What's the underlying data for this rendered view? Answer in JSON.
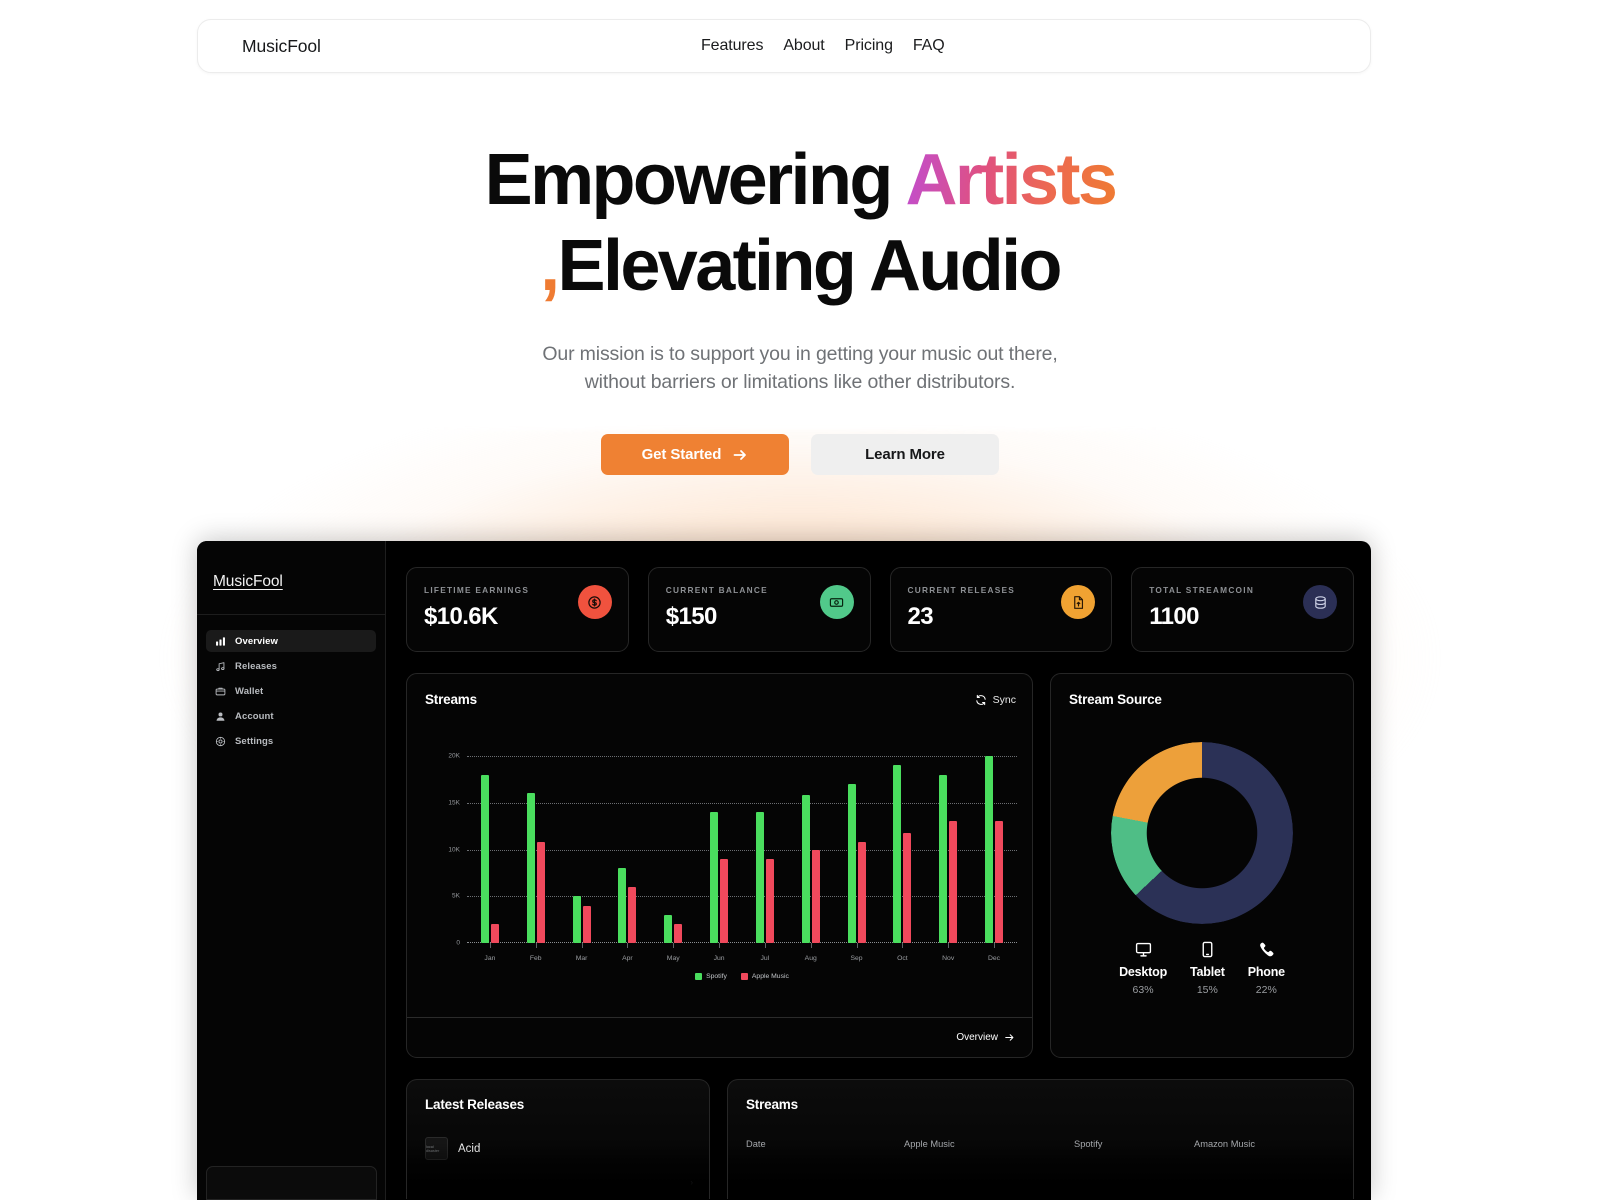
{
  "navbar": {
    "brand": "MusicFool",
    "links": [
      {
        "label": "Features"
      },
      {
        "label": "About"
      },
      {
        "label": "Pricing"
      },
      {
        "label": "FAQ"
      }
    ]
  },
  "hero": {
    "heading_part1": "Empowering",
    "heading_accent": "Artists",
    "heading_comma": ",",
    "heading_part2": "Elevating Audio",
    "subheading_line1": "Our mission is to support you in getting your music out there,",
    "subheading_line2": "without barriers or limitations like other distributors.",
    "cta_primary": "Get Started",
    "cta_secondary": "Learn More",
    "accent_gradient_from": "#c04ed1",
    "accent_gradient_to": "#ef7b32",
    "primary_button_color": "#ef8133"
  },
  "dashboard": {
    "sidebar": {
      "logo": "MusicFool",
      "items": [
        {
          "label": "Overview",
          "icon": "bar-chart-icon",
          "active": true
        },
        {
          "label": "Releases",
          "icon": "music-note-icon",
          "active": false
        },
        {
          "label": "Wallet",
          "icon": "wallet-icon",
          "active": false
        },
        {
          "label": "Account",
          "icon": "user-icon",
          "active": false
        },
        {
          "label": "Settings",
          "icon": "gear-icon",
          "active": false
        }
      ]
    },
    "stats": [
      {
        "caption": "LIFETIME EARNINGS",
        "value": "$10.6K",
        "icon": "dollar-coin-icon",
        "color": "#f0523e"
      },
      {
        "caption": "CURRENT BALANCE",
        "value": "$150",
        "icon": "banknote-icon",
        "color": "#51c98a"
      },
      {
        "caption": "CURRENT RELEASES",
        "value": "23",
        "icon": "file-upload-icon",
        "color": "#f0a232"
      },
      {
        "caption": "TOTAL STREAMCOIN",
        "value": "1100",
        "icon": "database-icon",
        "color": "#2b2f55"
      }
    ],
    "streams_card": {
      "title": "Streams",
      "sync_label": "Sync",
      "footer_link": "Overview"
    },
    "source_card": {
      "title": "Stream Source"
    },
    "latest_releases": {
      "title": "Latest Releases",
      "items": [
        {
          "name": "Acid",
          "art_label": "local disaster"
        }
      ],
      "row_more": "›"
    },
    "streams_table": {
      "title": "Streams",
      "columns": [
        "Date",
        "Apple Music",
        "Spotify",
        "Amazon Music"
      ]
    }
  },
  "chart_data": [
    {
      "type": "bar",
      "title": "Streams",
      "categories": [
        "Jan",
        "Feb",
        "Mar",
        "Apr",
        "May",
        "Jun",
        "Jul",
        "Aug",
        "Sep",
        "Oct",
        "Nov",
        "Dec"
      ],
      "series": [
        {
          "name": "Spotify",
          "color": "#4ade5e",
          "values": [
            18000,
            16000,
            5000,
            8000,
            3000,
            14000,
            14000,
            15800,
            17000,
            19000,
            18000,
            20000
          ]
        },
        {
          "name": "Apple Music",
          "color": "#f0495c",
          "values": [
            2000,
            10800,
            4000,
            6000,
            2000,
            9000,
            9000,
            10000,
            10800,
            11800,
            13000,
            13000
          ]
        }
      ],
      "ylim": [
        0,
        20000
      ],
      "yticks": [
        0,
        5000,
        10000,
        15000,
        20000
      ],
      "ytick_labels": [
        "0",
        "5K",
        "10K",
        "15K",
        "20K"
      ],
      "xlabel": "",
      "ylabel": "",
      "grid": true,
      "legend_position": "bottom"
    },
    {
      "type": "pie",
      "title": "Stream Source",
      "labels": [
        "Desktop",
        "Tablet",
        "Phone"
      ],
      "values": [
        63,
        15,
        22
      ],
      "value_labels": [
        "63%",
        "15%",
        "22%"
      ],
      "colors": [
        "#2b3156",
        "#4fbe86",
        "#eda03a"
      ],
      "icons": [
        "desktop-icon",
        "tablet-icon",
        "phone-icon"
      ],
      "donut": true,
      "legend_position": "bottom"
    }
  ]
}
